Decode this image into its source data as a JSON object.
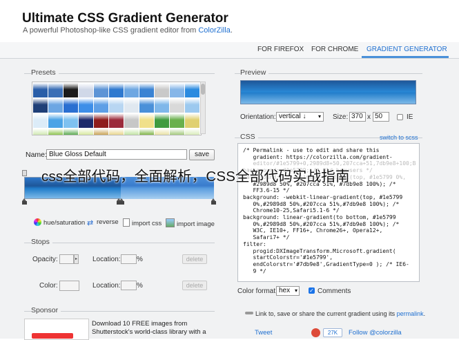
{
  "header": {
    "title": "Ultimate CSS Gradient Generator",
    "subtitle_prefix": "A powerful Photoshop-like CSS gradient editor from ",
    "subtitle_link": "ColorZilla",
    "subtitle_suffix": "."
  },
  "nav": {
    "tabs": [
      {
        "label": "FOR FIREFOX"
      },
      {
        "label": "FOR CHROME"
      },
      {
        "label": "GRADIENT GENERATOR"
      }
    ],
    "active_color": "#1e6fd0"
  },
  "presets": {
    "label": "Presets",
    "swatches": [
      [
        "#2a5ea8",
        "#3b6fb6",
        "#1b1b1b",
        "#d0d8e8",
        "#5d94d6",
        "#2f79cf",
        "#6ea7e2",
        "#3a83d3",
        "#c9c9c9",
        "#86b6e8",
        "#2b8be0"
      ],
      [
        "#1f3f77",
        "#6ca6e3",
        "#2a6fd1",
        "#3d8ee8",
        "#5e9fe6",
        "#b8d6f2",
        "#e0e8f0",
        "#4a90d9",
        "#7fb7ea",
        "#d9d9d9",
        "#9cc9ef"
      ],
      [
        "#dcecf8",
        "#4aa3e6",
        "#7ec1f0",
        "#1d2a6b",
        "#8e1d1d",
        "#9b2b3b",
        "#c7c7c7",
        "#f0e08a",
        "#3f9b3f",
        "#6ab04c",
        "#e0d070"
      ],
      [
        "#cfe8b0",
        "#8bc34a",
        "#56a84a",
        "#d6e89a",
        "#c8a050",
        "#e8d58a",
        "#bfe3a0",
        "#7cb342",
        "#e8e0a0",
        "#a0c878",
        "#d8ecb8"
      ]
    ]
  },
  "editor": {
    "name_label": "Name:",
    "name_value": "Blue Gloss Default",
    "save_label": "save",
    "tools": [
      {
        "label": "hue/saturation",
        "icon": "color-wheel-icon"
      },
      {
        "label": "reverse",
        "icon": "reverse-arrows-icon"
      },
      {
        "label": "import css",
        "icon": "import-css-icon"
      },
      {
        "label": "import image",
        "icon": "import-image-icon"
      }
    ]
  },
  "stops": {
    "label": "Stops",
    "opacity_label": "Opacity:",
    "location_label": "Location:",
    "color_label": "Color:",
    "percent": "%",
    "delete_label": "delete",
    "color_stops": [
      0,
      50,
      51,
      100
    ]
  },
  "sponsor": {
    "label": "Sponsor",
    "line1": "Download 10 FREE images from",
    "line2": "Shutterstock's world-class library with a"
  },
  "preview": {
    "label": "Preview",
    "orientation_label": "Orientation:",
    "orientation_value": "vertical ↓",
    "size_label": "Size:",
    "width_value": "370",
    "times": "x",
    "height_value": "50",
    "ie_label": "IE",
    "ie_checked": false
  },
  "css": {
    "label": "CSS",
    "switch_label": "switch to scss",
    "color_format_label": "Color format:",
    "color_format_value": "hex",
    "comments_label": "Comments",
    "comments_checked": true,
    "code_lines": [
      {
        "text": "/* Permalink - use to edit and share this",
        "faded": false
      },
      {
        "text": "   gradient: https://colorzilla.com/gradient-",
        "faded": false
      },
      {
        "text": "   editor/#1e5799+0,2989d8+50,207cca+51,7db9e8+100;B",
        "faded": true
      },
      {
        "text": "background: #1e5799; /* Old browsers */",
        "faded": true
      },
      {
        "text": "background: -moz-linear-gradient(top, #1e5799 0%,",
        "faded": true
      },
      {
        "text": "   #2989d8 50%, #207cca 51%, #7db9e8 100%); /*",
        "faded": false
      },
      {
        "text": "   FF3.6-15 */",
        "faded": false
      },
      {
        "text": "background: -webkit-linear-gradient(top, #1e5799",
        "faded": false
      },
      {
        "text": "   0%,#2989d8 50%,#207cca 51%,#7db9e8 100%); /*",
        "faded": false
      },
      {
        "text": "   Chrome10-25,Safari5.1-6 */",
        "faded": false
      },
      {
        "text": "background: linear-gradient(to bottom, #1e5799",
        "faded": false
      },
      {
        "text": "   0%,#2989d8 50%,#207cca 51%,#7db9e8 100%); /*",
        "faded": false
      },
      {
        "text": "   W3C, IE10+, FF16+, Chrome26+, Opera12+,",
        "faded": false
      },
      {
        "text": "   Safari7+ */",
        "faded": false
      },
      {
        "text": "filter:",
        "faded": false
      },
      {
        "text": "   progid:DXImageTransform.Microsoft.gradient(",
        "faded": false
      },
      {
        "text": "   startColorstr='#1e5799',",
        "faded": false
      },
      {
        "text": "   endColorstr='#7db9e8',GradientType=0 ); /* IE6-",
        "faded": false
      },
      {
        "text": "   9 */",
        "faded": false
      }
    ]
  },
  "permalink": {
    "prefix": "Link to, save or share the current gradient using its ",
    "link": "permalink",
    "suffix": "."
  },
  "social": {
    "tweet": "Tweet",
    "count": "27K",
    "follow": "Follow @colorzilla"
  },
  "overlay": {
    "text": "css全部代码，全面解析，CSS全部代码实战指南"
  }
}
